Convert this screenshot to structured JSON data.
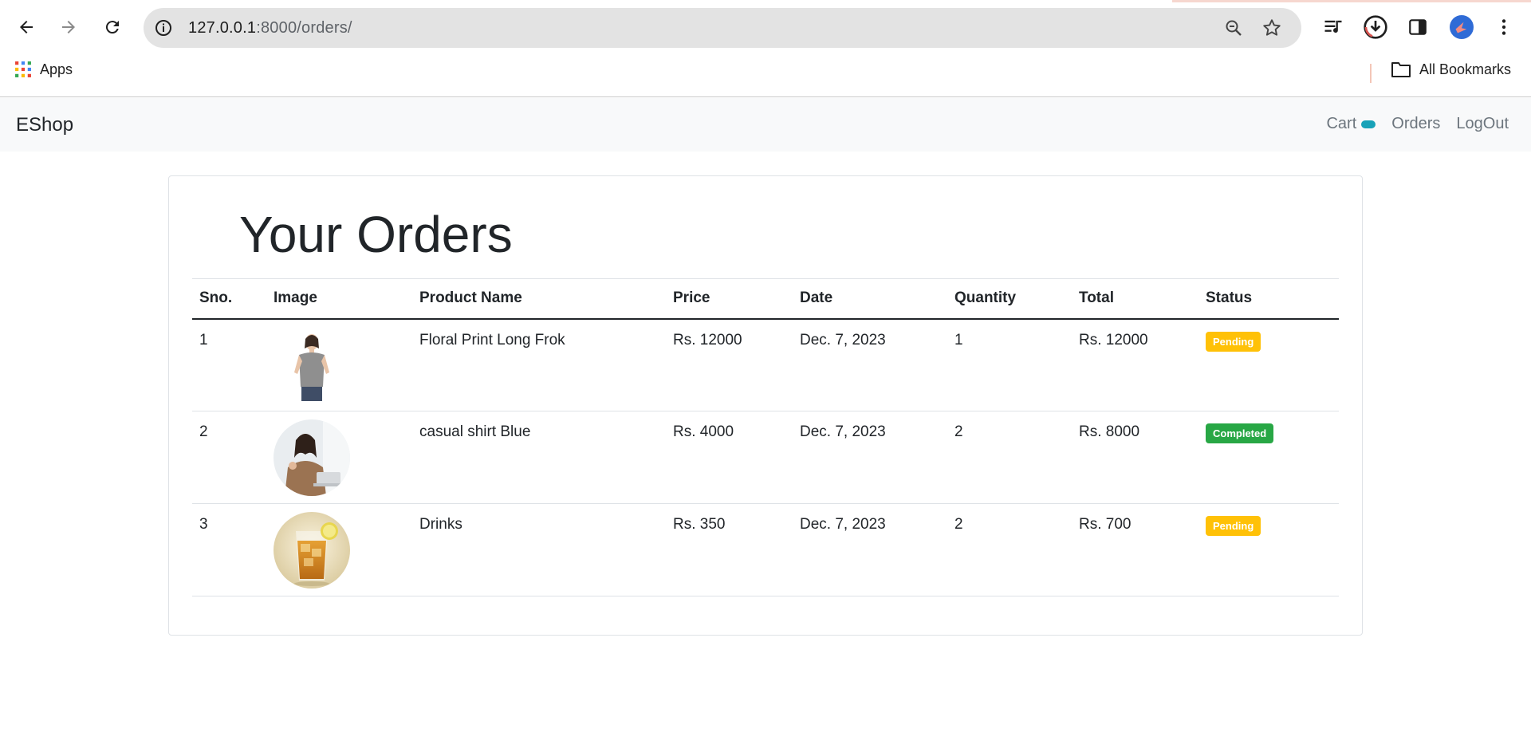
{
  "browser": {
    "url_host": "127.0.0.1",
    "url_path": ":8000/orders/",
    "bookmarks": {
      "apps_label": "Apps",
      "all_bookmarks_label": "All Bookmarks"
    }
  },
  "navbar": {
    "brand": "EShop",
    "links": {
      "cart": "Cart",
      "orders": "Orders",
      "logout": "LogOut"
    }
  },
  "page": {
    "title": "Your Orders"
  },
  "table": {
    "headers": {
      "sno": "Sno.",
      "image": "Image",
      "name": "Product Name",
      "price": "Price",
      "date": "Date",
      "qty": "Quantity",
      "total": "Total",
      "status": "Status"
    },
    "rows": [
      {
        "sno": "1",
        "image": "woman-grey-top-photo",
        "name": "Floral Print Long Frok",
        "price": "Rs. 12000",
        "date": "Dec. 7, 2023",
        "qty": "1",
        "total": "Rs. 12000",
        "status": "Pending"
      },
      {
        "sno": "2",
        "image": "woman-brown-sweater-photo",
        "name": "casual shirt Blue",
        "price": "Rs. 4000",
        "date": "Dec. 7, 2023",
        "qty": "2",
        "total": "Rs. 8000",
        "status": "Completed"
      },
      {
        "sno": "3",
        "image": "iced-drink-photo",
        "name": "Drinks",
        "price": "Rs. 350",
        "date": "Dec. 7, 2023",
        "qty": "2",
        "total": "Rs. 700",
        "status": "Pending"
      }
    ]
  },
  "colors": {
    "pending": "#ffc107",
    "completed": "#28a745",
    "cart_badge": "#17a2b8"
  }
}
